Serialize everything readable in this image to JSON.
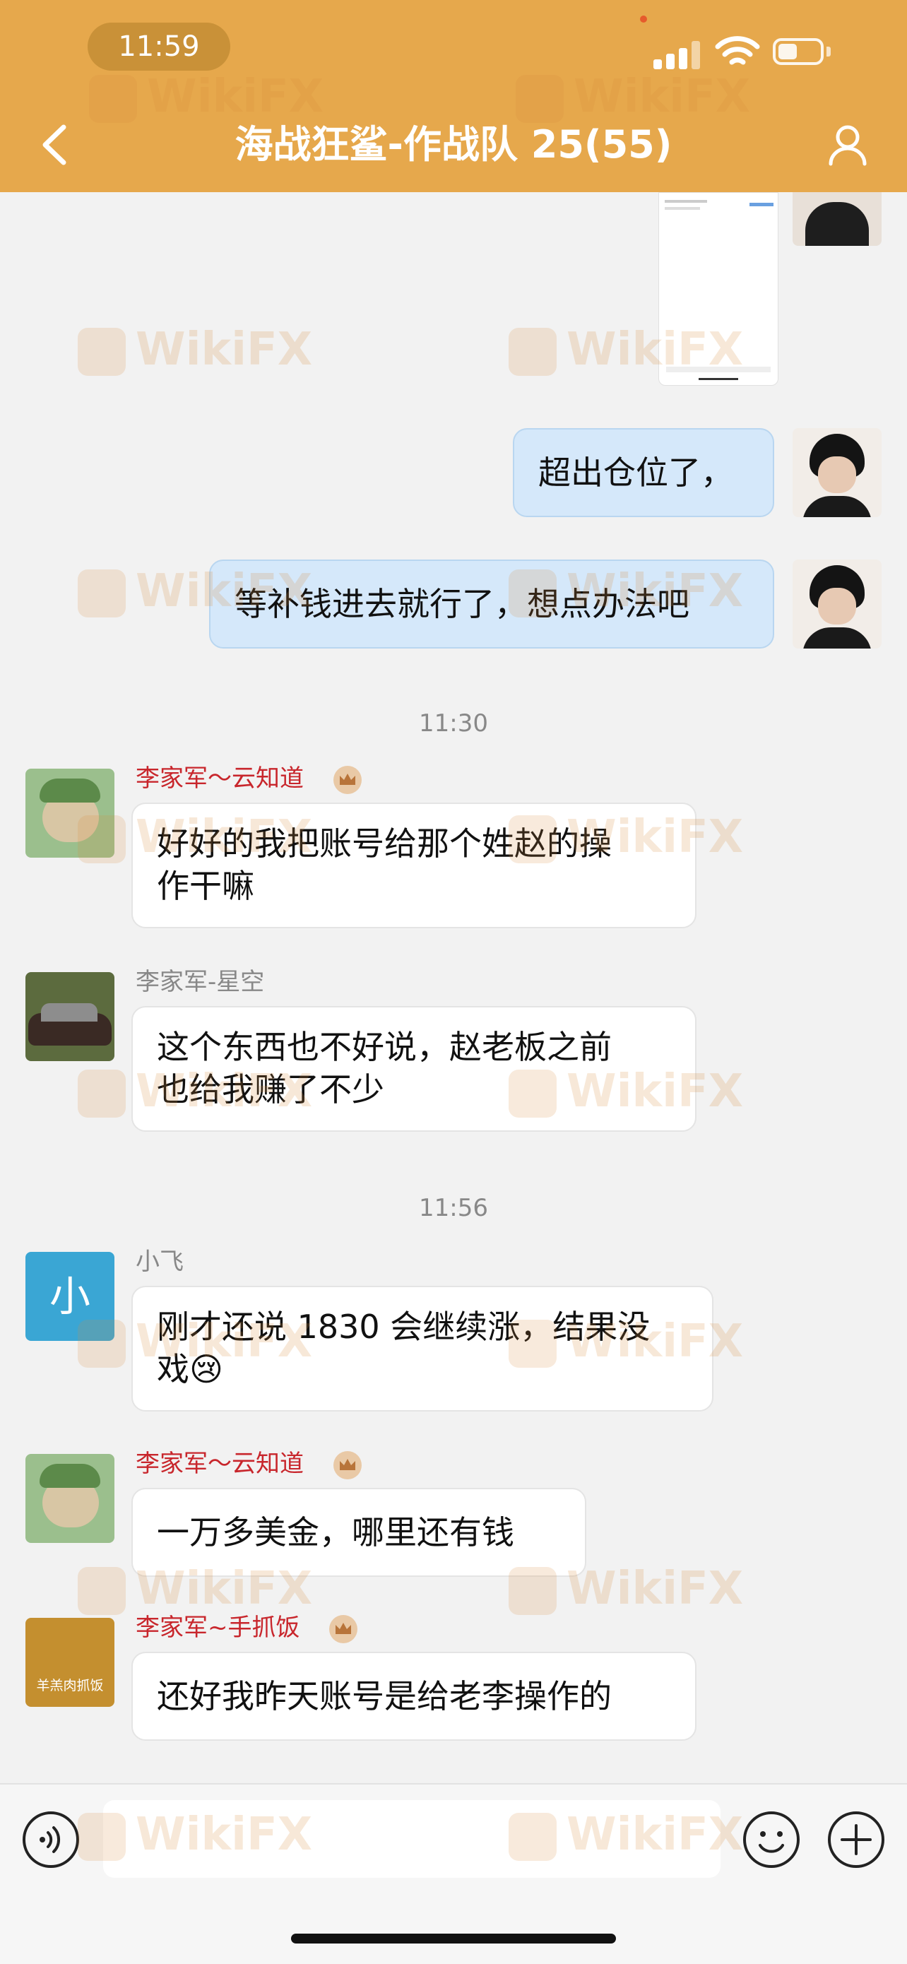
{
  "status_bar": {
    "time": "11:59"
  },
  "header": {
    "title": "海战狂鲨-作战队 25(55)"
  },
  "watermark": "WikiFX",
  "messages": {
    "m1": {
      "text": "超出仓位了，"
    },
    "m2": {
      "text": "等补钱进去就行了，想点办法吧"
    },
    "t1": "11:30",
    "m3": {
      "sender": "李家军～云知道",
      "text_line1": "好好的我把账号给那个姓赵的操",
      "text_line2": "作干嘛"
    },
    "m4": {
      "sender": "李家军-星空",
      "text_line1": "这个东西也不好说，赵老板之前",
      "text_line2": "也给我赚了不少"
    },
    "t2": "11:56",
    "m5": {
      "sender": "小飞",
      "avatar_text": "小",
      "text_line1": "刚才还说 1830 会继续涨，结果没",
      "text_line2": "戏",
      "emoji": "😢"
    },
    "m6": {
      "sender": "李家军～云知道",
      "text": "一万多美金，哪里还有钱"
    },
    "m7": {
      "sender": "李家军~手抓饭",
      "avatar_text": "羊羔肉抓饭",
      "text": "还好我昨天账号是给老李操作的"
    }
  },
  "colors": {
    "header": "#e6a84c",
    "sender_highlight": "#c8262c",
    "out_bubble": "#d5e8fa"
  },
  "icons": [
    "chevron-left-icon",
    "person-icon",
    "voice-icon",
    "emoji-icon",
    "plus-icon",
    "crown-icon"
  ]
}
